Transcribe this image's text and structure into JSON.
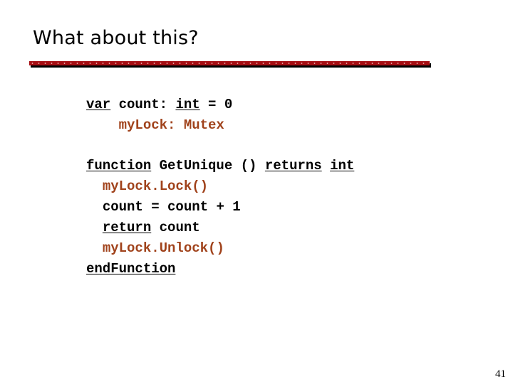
{
  "slide": {
    "title": "What about this?",
    "page_number": "41",
    "colors": {
      "accent": "#a50d12",
      "lock_text": "#a0421b",
      "text": "#000000"
    },
    "code": {
      "line1": {
        "kw_var": "var",
        "rest1": " count: ",
        "kw_int": "int",
        "rest2": " = 0"
      },
      "line2": {
        "indent": "    ",
        "text": "myLock: Mutex"
      },
      "line3": {
        "kw_function": "function",
        "mid": " GetUnique () ",
        "kw_returns": "returns",
        "sp": " ",
        "kw_int": "int"
      },
      "line4": {
        "indent": "  ",
        "text": "myLock.Lock()"
      },
      "line5": {
        "indent": "  ",
        "text": "count = count + 1"
      },
      "line6": {
        "indent": "  ",
        "kw_return": "return",
        "rest": " count"
      },
      "line7": {
        "indent": "  ",
        "text": "myLock.Unlock()"
      },
      "line8": {
        "kw_end": "endFunction"
      }
    }
  }
}
